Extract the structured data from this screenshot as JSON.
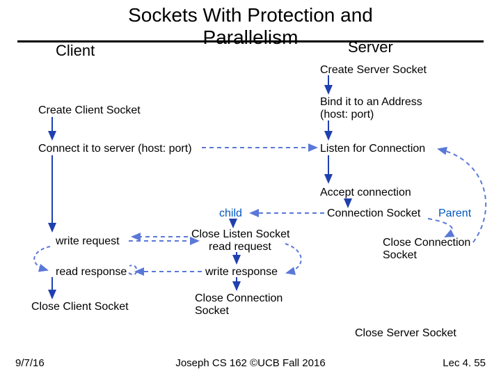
{
  "title_line1": "Sockets With Protection and",
  "title_line2": "Parallelism",
  "client_header": "Client",
  "server_header": "Server",
  "server": {
    "create": "Create Server Socket",
    "bind1": "Bind it to an Address",
    "bind2": "(host: port)",
    "listen": "Listen for Connection",
    "accept": "Accept connection",
    "conn_sock": "Connection Socket",
    "parent": "Parent",
    "close_conn": "Close Connection",
    "close_conn2": "Socket",
    "close_srv": "Close Server Socket"
  },
  "client": {
    "create": "Create Client Socket",
    "connect": "Connect it to server (host: port)",
    "write_req": "write request",
    "read_resp": "read response",
    "close": "Close Client Socket"
  },
  "child": {
    "label": "child",
    "close_listen1": "Close Listen Socket",
    "close_listen2": "read request",
    "write_resp": "write response",
    "close_conn1": "Close Connection",
    "close_conn2": "Socket"
  },
  "footer": {
    "date": "9/7/16",
    "center": "Joseph CS 162 ©UCB Fall 2016",
    "right": "Lec 4. 55"
  }
}
